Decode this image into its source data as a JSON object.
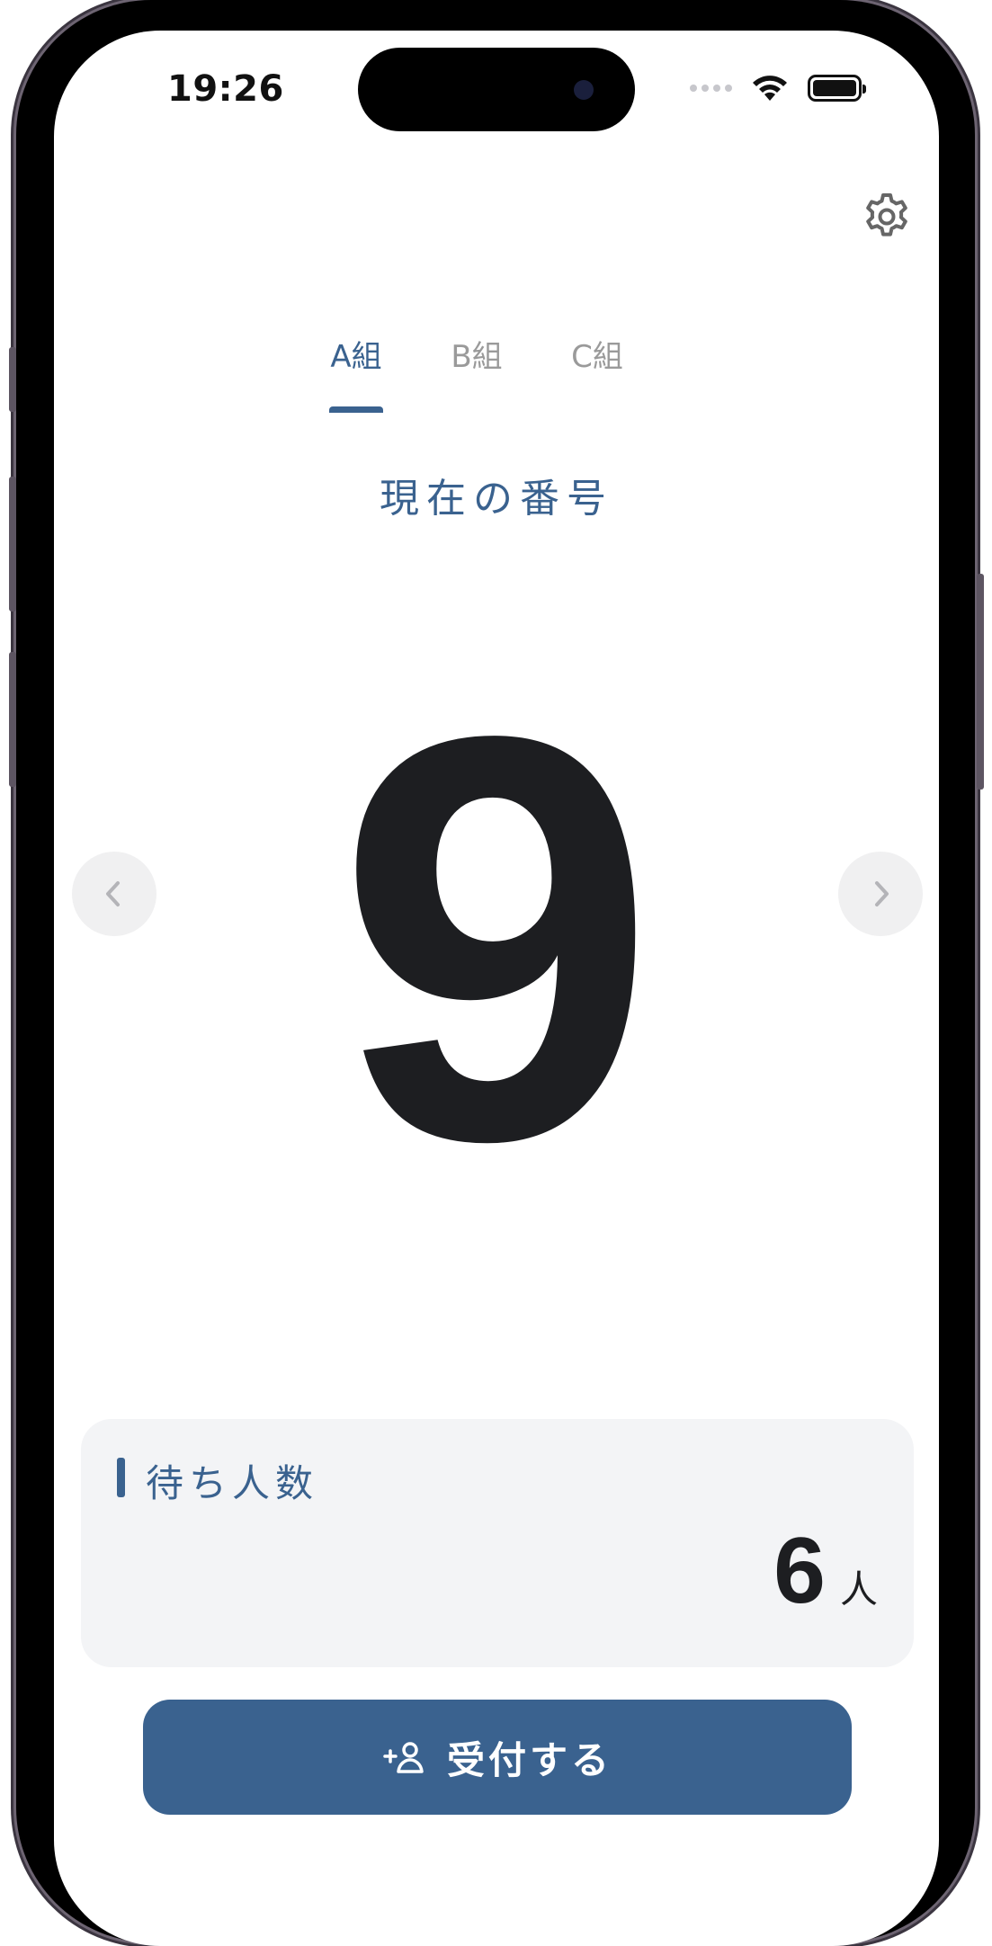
{
  "status_bar": {
    "time": "19:26"
  },
  "tabs": [
    {
      "label": "A組",
      "active": true
    },
    {
      "label": "B組",
      "active": false
    },
    {
      "label": "C組",
      "active": false
    }
  ],
  "current": {
    "label": "現在の番号",
    "number": "9"
  },
  "waiting": {
    "label": "待ち人数",
    "count": "6",
    "unit": "人"
  },
  "accept_button": {
    "label": "受付する"
  },
  "colors": {
    "accent": "#3a628f",
    "text_dark": "#1d1e21",
    "tab_inactive": "#9a9a9a",
    "card_bg": "#f3f4f6",
    "nav_btn_bg": "#f0f0f1"
  },
  "icons": {
    "settings": "gear-icon",
    "previous": "chevron-left-icon",
    "next": "chevron-right-icon",
    "accept": "person-add-icon",
    "wifi": "wifi-icon",
    "battery": "battery-icon"
  }
}
